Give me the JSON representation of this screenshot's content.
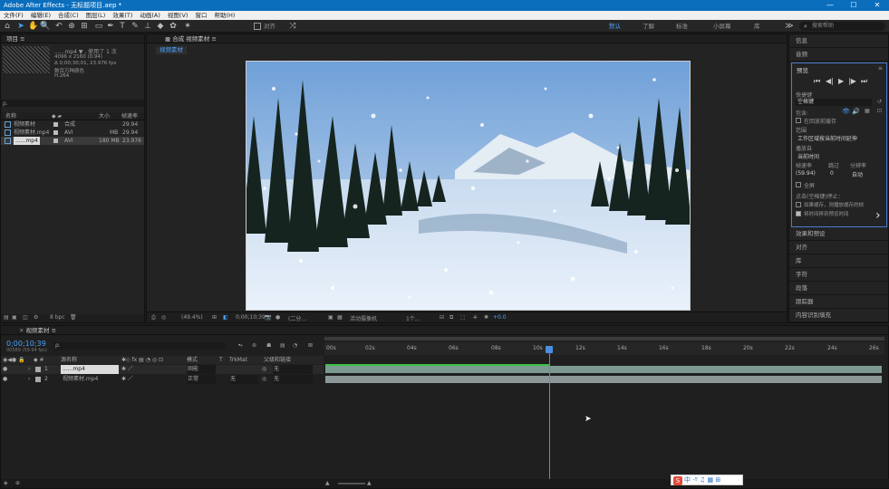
{
  "titlebar": {
    "title": "Adobe After Effects - 无标题项目.aep *",
    "min": "—",
    "max": "☐",
    "close": "✕"
  },
  "menu": [
    "文件(F)",
    "编辑(E)",
    "合成(C)",
    "图层(L)",
    "效果(T)",
    "动画(A)",
    "视图(V)",
    "窗口",
    "帮助(H)"
  ],
  "toolbar": {
    "align_label": "对齐",
    "workspaces": [
      "默认",
      "了解",
      "标准",
      "小屏幕",
      "库"
    ],
    "search_placeholder": "搜索帮助"
  },
  "project": {
    "panel_title": "项目 ≡",
    "selected_name": "......mp4 ▼ , 使用了 1 次",
    "meta1": "4096 x 2160 (0.94)",
    "meta2": "Δ 0;00;30;01, 23.976 fps",
    "meta3": "数百万种颜色",
    "meta4": "H.264",
    "search_placeholder": "ρ.",
    "columns": {
      "name": "名称",
      "size": "大小",
      "fps": "帧速率"
    },
    "items": [
      {
        "name": "视频素材",
        "type": "合成",
        "size": "",
        "fps": "29.94"
      },
      {
        "name": "视频素材.mp4",
        "type": "AVI",
        "size": "MB",
        "fps": "29.94"
      },
      {
        "name": "......mp4",
        "type": "AVI",
        "size": "180 MB",
        "fps": "23.976"
      }
    ],
    "bpc": "8 bpc"
  },
  "composition": {
    "tab_label": "合成 视频素材 ≡",
    "sub_tab": "视频素材",
    "zoom": "(49.4%)",
    "timecode": "0;00;10;39",
    "resolution": "(二分...",
    "camera": "活动摄像机",
    "views": "1个...",
    "exposure": "+0.0"
  },
  "right_panel": {
    "info": "信息",
    "audio": "音频",
    "preview_title": "预览",
    "shortcut_label": "快捷键",
    "shortcut_value": "空格键",
    "include_label": "包含:",
    "cache_label": "在回放前缓存",
    "range_label": "范围",
    "range_value": "工作区域按当前时间延伸",
    "play_from_label": "播放自",
    "play_from_value": "当前时间",
    "fps_label": "帧速率",
    "skip_label": "跳过",
    "res_label": "分辨率",
    "fps_value": "(59.94)",
    "skip_value": "0",
    "res_value": "自动",
    "fullscreen": "全屏",
    "stop_label": "点击(空格键)停止：",
    "cache_opt": "如果缓存，则播放缓存的帧",
    "move_opt": "将时间移到预览时间",
    "others": [
      "效果和预设",
      "对齐",
      "库",
      "字符",
      "段落",
      "跟踪器",
      "内容识别填充"
    ]
  },
  "timeline": {
    "tab_label": "视频素材 ≡",
    "timecode": "0;00;10;39",
    "timecode_sub": "00589 (59.94 fps)",
    "columns": {
      "src": "源名称",
      "mode": "模式",
      "t": "T",
      "trkmat": "TrkMat",
      "parent": "父级和链接"
    },
    "layers": [
      {
        "num": "1",
        "name": "......mp4",
        "mode": "固能",
        "parent": "无"
      },
      {
        "num": "2",
        "name": "视频素材.mp4",
        "mode": "正常",
        "trkmat": "无",
        "parent": "无"
      }
    ],
    "ticks": [
      "00s",
      "02s",
      "04s",
      "06s",
      "08s",
      "10s",
      "12s",
      "14s",
      "16s",
      "18s",
      "20s",
      "22s",
      "24s",
      "26s"
    ],
    "playhead_seconds": 10.65,
    "duration_seconds": 26.5
  },
  "ime": {
    "label": "中 ·º ♫ ▦ ⊞"
  }
}
